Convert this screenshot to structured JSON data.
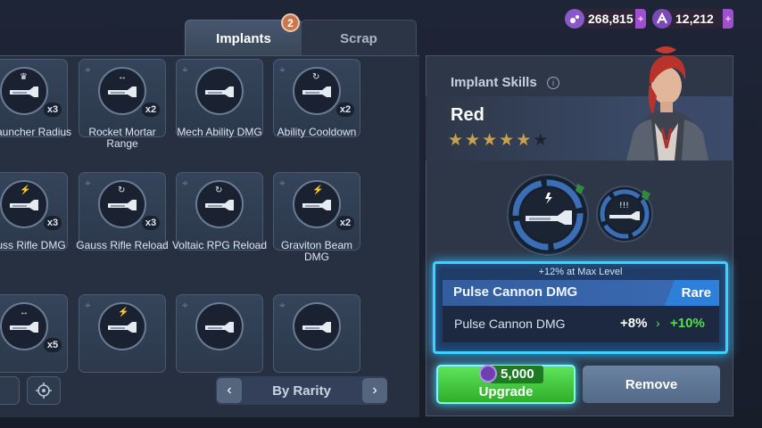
{
  "currency": [
    {
      "icon": "purple-gem-icon",
      "value": "268,815",
      "plus": "+"
    },
    {
      "icon": "a-token-icon",
      "value": "12,212",
      "plus": "+"
    }
  ],
  "tabs": [
    {
      "label": "Implants",
      "badge": "2",
      "active": true
    },
    {
      "label": "Scrap",
      "active": false
    }
  ],
  "implants": [
    {
      "label": "sc Launcher Radius",
      "count": "x3",
      "icon": "disc-launcher-icon",
      "mark": "crown"
    },
    {
      "label": "Rocket Mortar Range",
      "count": "x2",
      "icon": "rocket-mortar-icon",
      "mark": "arrows"
    },
    {
      "label": "Mech Ability DMG",
      "count": "",
      "icon": "mech-ability-icon",
      "mark": "none"
    },
    {
      "label": "Ability Cooldown",
      "count": "x2",
      "icon": "ability-cooldown-icon",
      "mark": "refresh"
    },
    {
      "label": "Gauss Rifle DMG",
      "count": "x3",
      "icon": "gauss-rifle-icon",
      "mark": "bolt"
    },
    {
      "label": "Gauss Rifle Reload",
      "count": "x3",
      "icon": "gauss-rifle-icon",
      "mark": "refresh"
    },
    {
      "label": "Voltaic RPG Reload",
      "count": "",
      "icon": "voltaic-rpg-icon",
      "mark": "refresh"
    },
    {
      "label": "Graviton Beam DMG",
      "count": "x2",
      "icon": "graviton-beam-icon",
      "mark": "bolt"
    },
    {
      "label": "",
      "count": "x5",
      "icon": "jet-icon",
      "mark": "arrows"
    },
    {
      "label": "",
      "count": "",
      "icon": "jet-icon",
      "mark": "bolt"
    },
    {
      "label": "",
      "count": "",
      "icon": "orbit-planet-icon",
      "mark": "none"
    },
    {
      "label": "",
      "count": "",
      "icon": "shield-burst-icon",
      "mark": "none"
    }
  ],
  "controls": {
    "sort_label": "By Rarity",
    "prev": "‹",
    "next": "›"
  },
  "skills": {
    "title": "Implant Skills",
    "info": "i",
    "hero_name": "Red",
    "stars_filled": 5,
    "stars_total": 6
  },
  "detail": {
    "max_level_note": "+12% at Max Level",
    "name": "Pulse Cannon DMG",
    "rarity": "Rare",
    "stat_name": "Pulse Cannon DMG",
    "current": "+8%",
    "arrow": "›",
    "upgraded": "+10%"
  },
  "buttons": {
    "upgrade_cost": "5,000",
    "upgrade_label": "Upgrade",
    "remove_label": "Remove"
  },
  "colors": {
    "accent_glow": "#3ad2ff",
    "upgrade_green": "#3fbf3a",
    "rare_blue": "#2e7fd9",
    "star_gold": "#c7a24a"
  }
}
